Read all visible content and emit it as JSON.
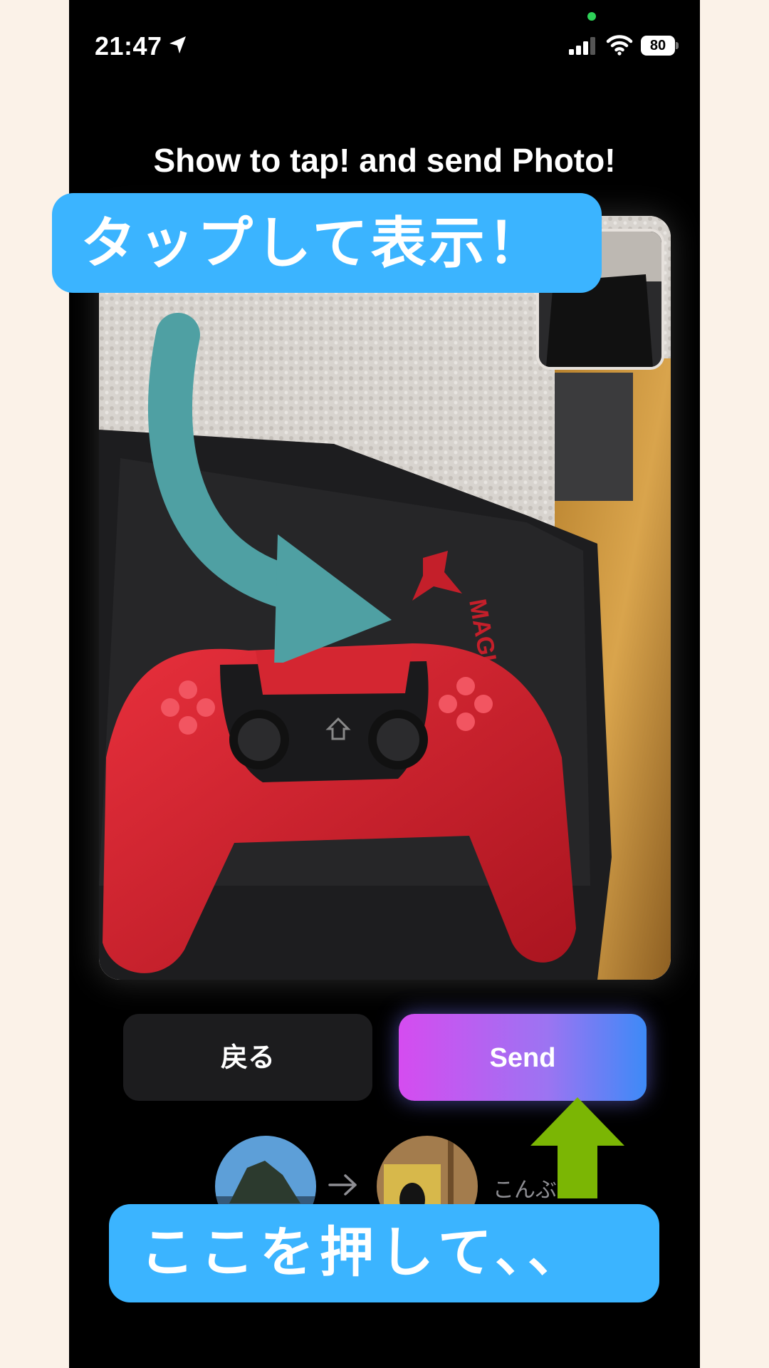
{
  "status_bar": {
    "time": "21:47",
    "battery": "80",
    "icons": [
      "location-arrow-icon",
      "cellular-signal-icon",
      "wifi-icon",
      "battery-charging-icon"
    ]
  },
  "screen": {
    "headline": "Show to tap! and send Photo!",
    "photo_description_icon": "photo-preview",
    "buttons": {
      "back_label": "戻る",
      "send_label": "Send"
    },
    "send_flow": {
      "recipient_name": "こんぶ",
      "arrow_icon": "arrow-right-icon"
    }
  },
  "annotations": {
    "top_callout": "タップして表示！",
    "bottom_callout": "ここを押して、、",
    "curved_arrow_color": "#4fa0a3",
    "up_arrow_color": "#7bb604",
    "callout_color": "#3bb4ff"
  },
  "colors": {
    "background": "#fbf2e8",
    "phone": "#000000",
    "back_button": "#1c1c1e",
    "send_gradient_start": "#d54cf0",
    "send_gradient_end": "#3d8af7"
  }
}
